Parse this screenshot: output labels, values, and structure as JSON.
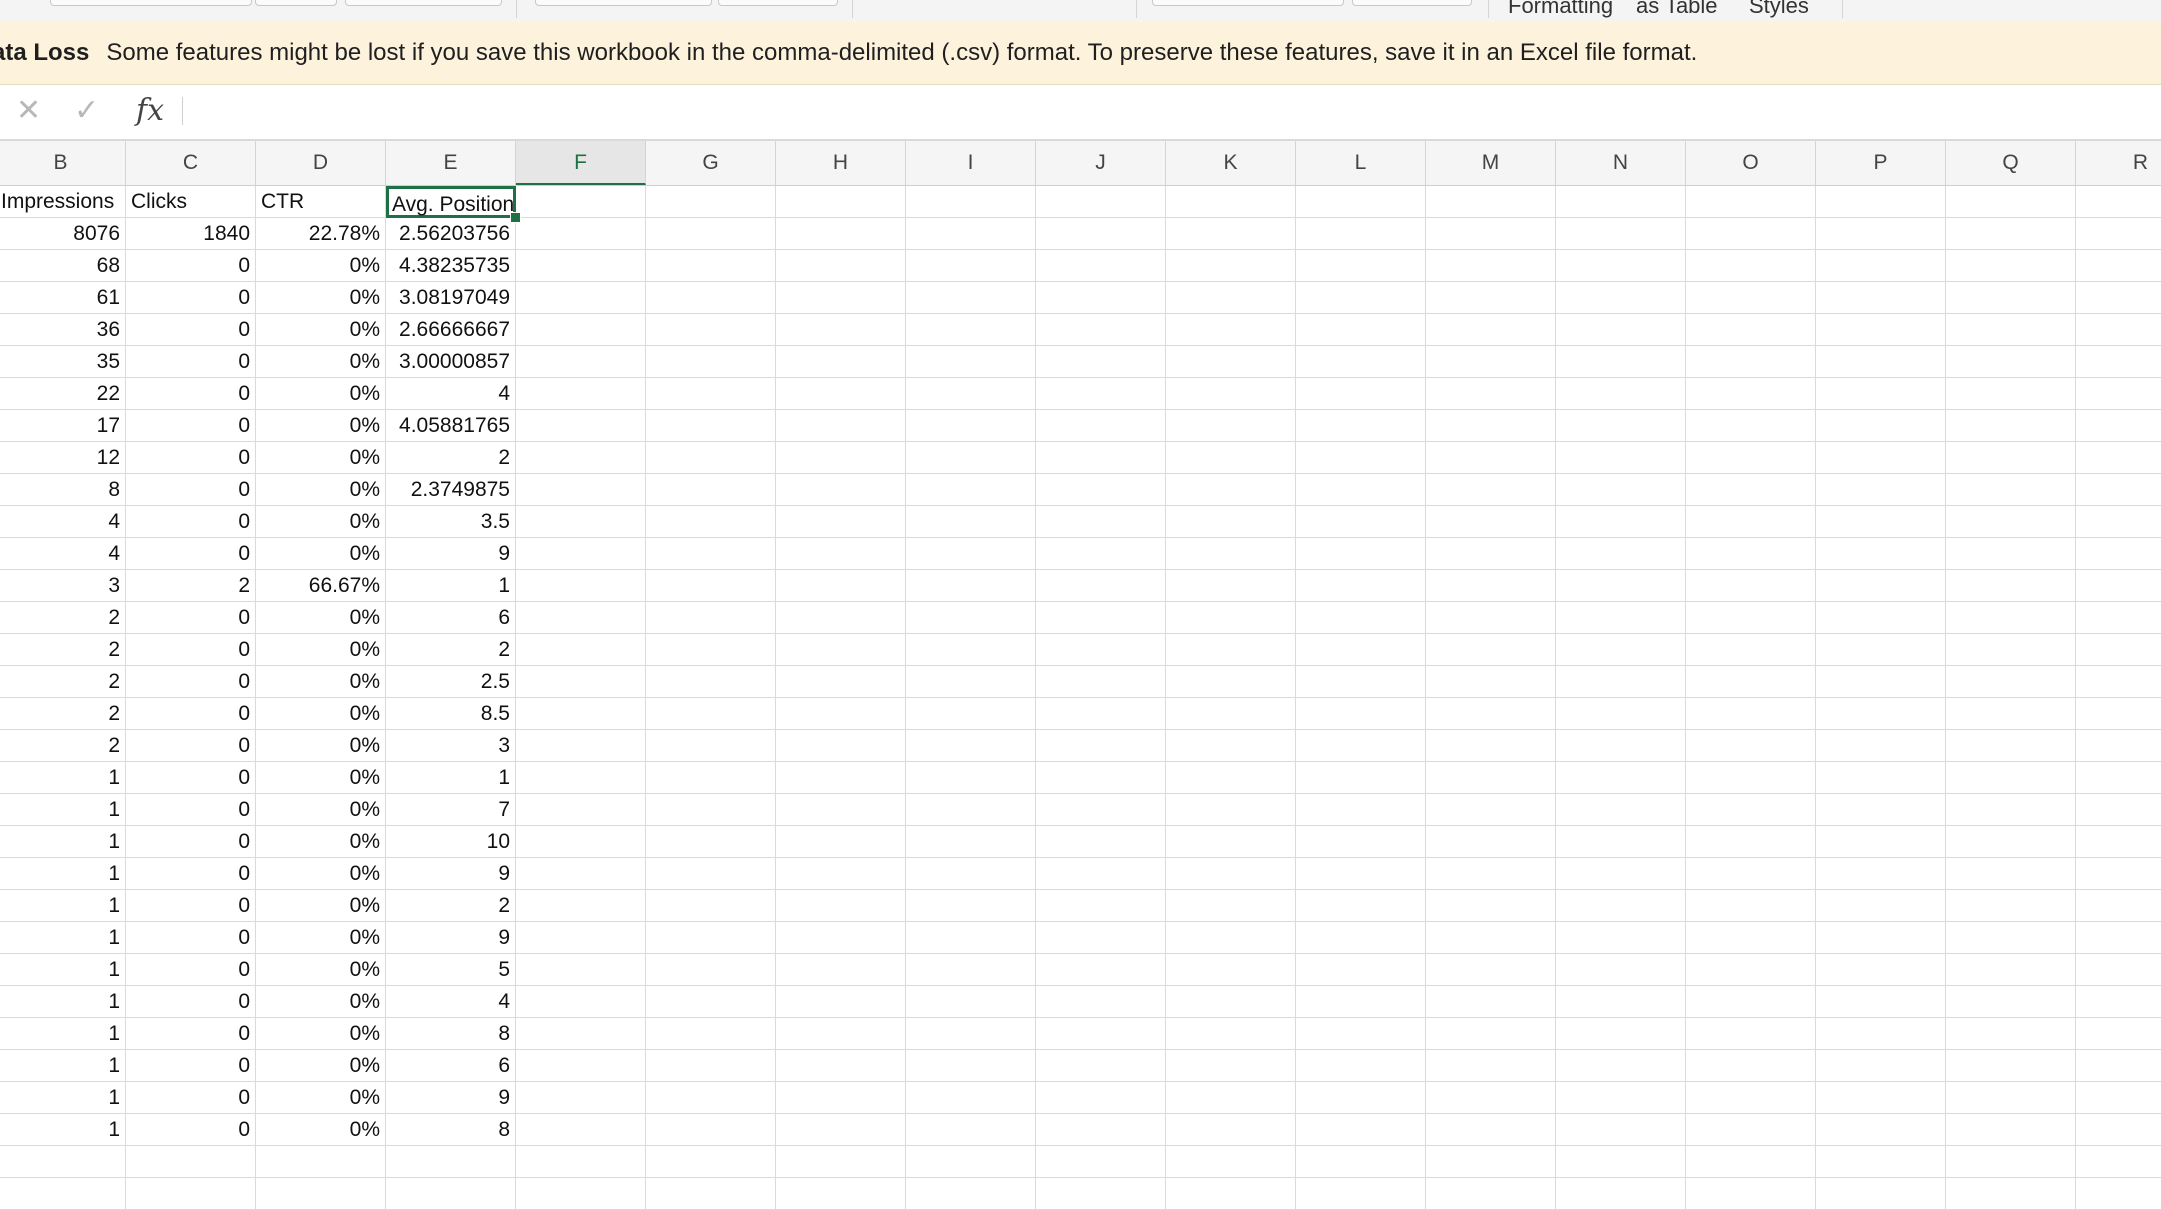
{
  "ribbon": {
    "labels": [
      "Formatting",
      "as Table",
      "Styles"
    ]
  },
  "message_bar": {
    "title": "ata Loss",
    "text": "Some features might be lost if you save this workbook in the comma-delimited (.csv) format. To preserve these features, save it in an Excel file format."
  },
  "formula_bar": {
    "cancel_icon": "✕",
    "enter_icon": "✓",
    "fx_label": "fx",
    "value": ""
  },
  "columns": [
    "B",
    "C",
    "D",
    "E",
    "F",
    "G",
    "H",
    "I",
    "J",
    "K",
    "L",
    "M",
    "N",
    "O",
    "P",
    "Q",
    "R"
  ],
  "active_column": "F",
  "selected_cell": "E1",
  "colors": {
    "accent": "#1e7145",
    "message_bg": "#fdf3dd"
  },
  "table": {
    "headers": [
      "Impressions",
      "Clicks",
      "CTR",
      "Avg. Position"
    ],
    "rows": [
      [
        "8076",
        "1840",
        "22.78%",
        "2.56203756"
      ],
      [
        "68",
        "0",
        "0%",
        "4.38235735"
      ],
      [
        "61",
        "0",
        "0%",
        "3.08197049"
      ],
      [
        "36",
        "0",
        "0%",
        "2.66666667"
      ],
      [
        "35",
        "0",
        "0%",
        "3.00000857"
      ],
      [
        "22",
        "0",
        "0%",
        "4"
      ],
      [
        "17",
        "0",
        "0%",
        "4.05881765"
      ],
      [
        "12",
        "0",
        "0%",
        "2"
      ],
      [
        "8",
        "0",
        "0%",
        "2.3749875"
      ],
      [
        "4",
        "0",
        "0%",
        "3.5"
      ],
      [
        "4",
        "0",
        "0%",
        "9"
      ],
      [
        "3",
        "2",
        "66.67%",
        "1"
      ],
      [
        "2",
        "0",
        "0%",
        "6"
      ],
      [
        "2",
        "0",
        "0%",
        "2"
      ],
      [
        "2",
        "0",
        "0%",
        "2.5"
      ],
      [
        "2",
        "0",
        "0%",
        "8.5"
      ],
      [
        "2",
        "0",
        "0%",
        "3"
      ],
      [
        "1",
        "0",
        "0%",
        "1"
      ],
      [
        "1",
        "0",
        "0%",
        "7"
      ],
      [
        "1",
        "0",
        "0%",
        "10"
      ],
      [
        "1",
        "0",
        "0%",
        "9"
      ],
      [
        "1",
        "0",
        "0%",
        "2"
      ],
      [
        "1",
        "0",
        "0%",
        "9"
      ],
      [
        "1",
        "0",
        "0%",
        "5"
      ],
      [
        "1",
        "0",
        "0%",
        "4"
      ],
      [
        "1",
        "0",
        "0%",
        "8"
      ],
      [
        "1",
        "0",
        "0%",
        "6"
      ],
      [
        "1",
        "0",
        "0%",
        "9"
      ],
      [
        "1",
        "0",
        "0%",
        "8"
      ]
    ]
  }
}
